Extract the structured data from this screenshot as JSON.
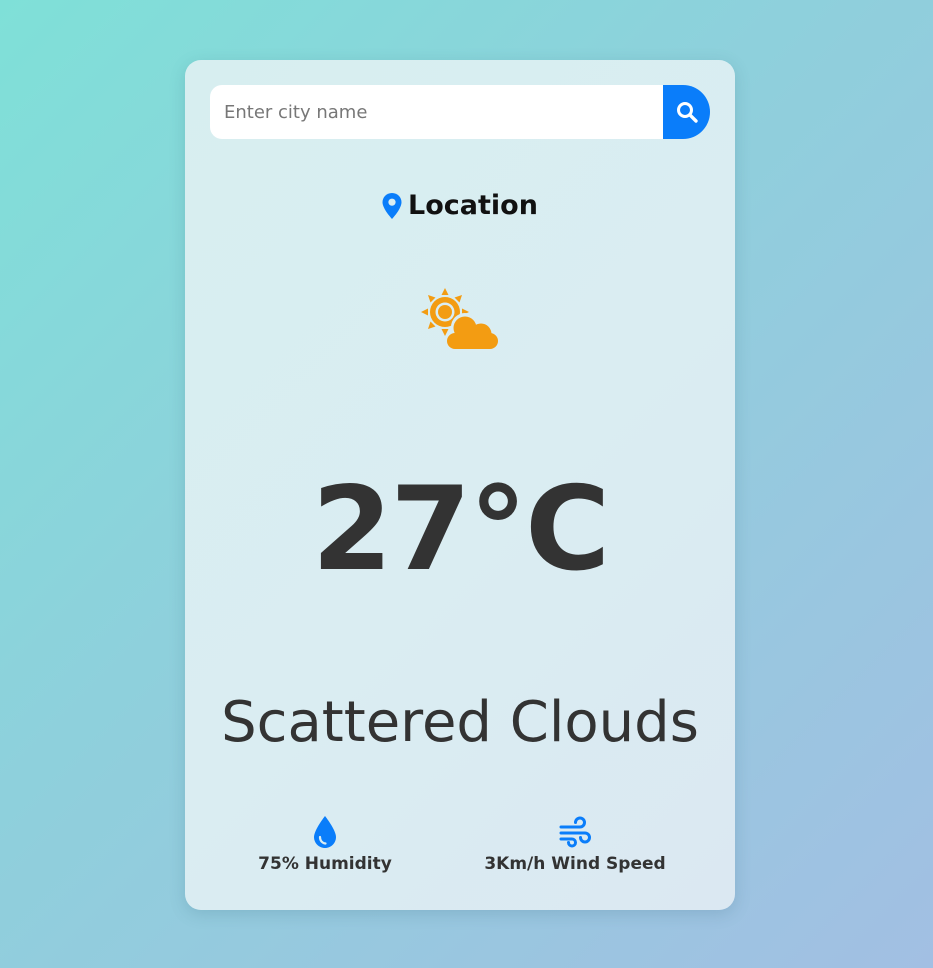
{
  "search": {
    "placeholder": "Enter city name",
    "value": "",
    "button_icon": "search-icon"
  },
  "location": {
    "icon": "map-pin-icon",
    "label": "Location"
  },
  "weather": {
    "icon": "partly-cloudy-icon",
    "temperature": "27°C",
    "description": "Scattered Clouds"
  },
  "stats": {
    "humidity": {
      "icon": "water-drop-icon",
      "label": "75% Humidity"
    },
    "wind": {
      "icon": "wind-icon",
      "label": "3Km/h Wind Speed"
    }
  },
  "colors": {
    "accent": "#0a7dfa",
    "weather_icon": "#f39c12",
    "text": "#333333"
  }
}
